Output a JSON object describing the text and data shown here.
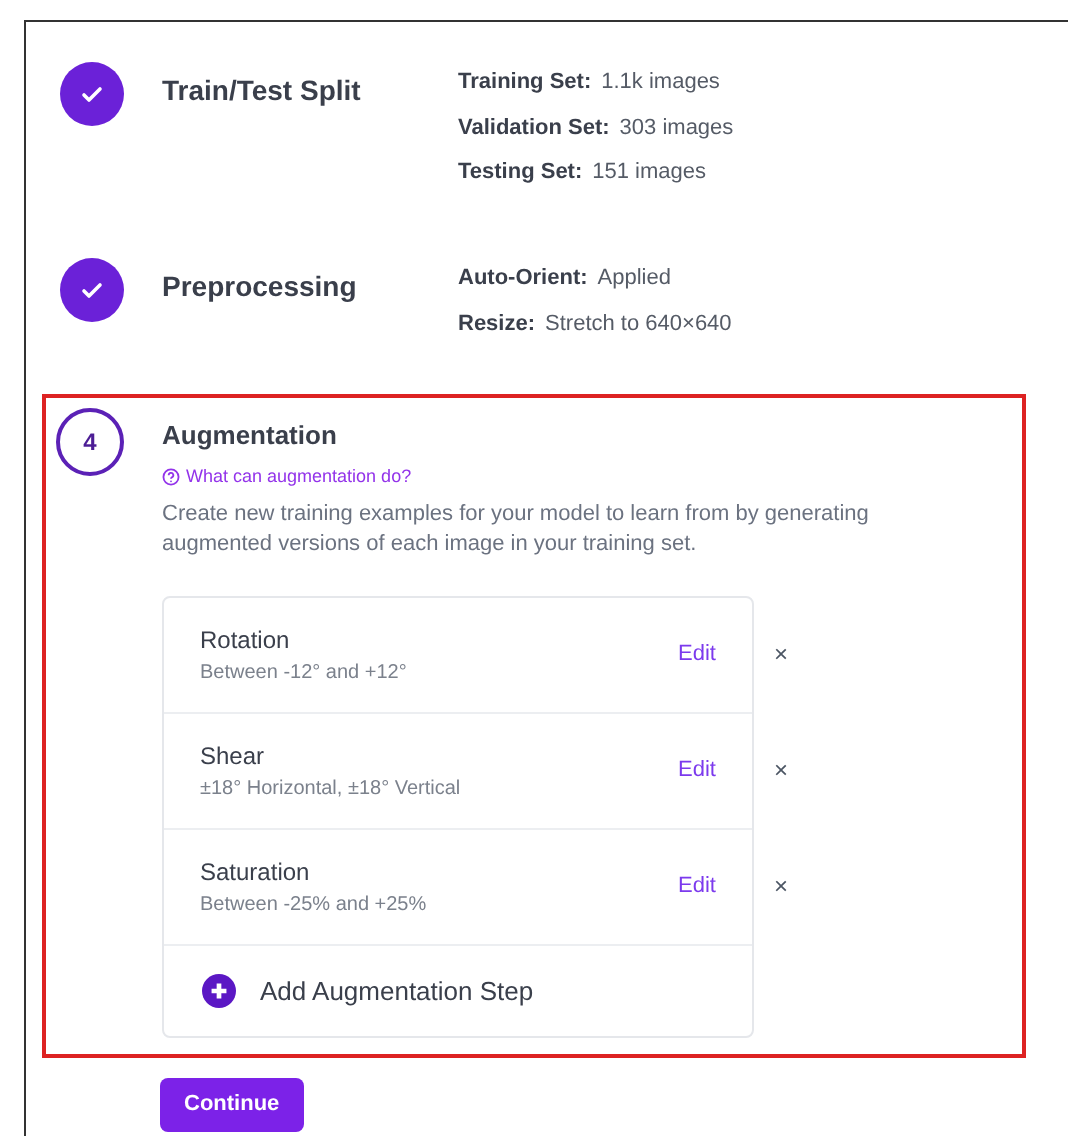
{
  "steps": [
    {
      "kind": "done",
      "title": "Train/Test Split",
      "details": [
        {
          "label": "Training Set:",
          "value": "1.1k images"
        },
        {
          "label": "Validation Set:",
          "value": "303 images"
        },
        {
          "label": "Testing Set:",
          "value": "151 images"
        }
      ]
    },
    {
      "kind": "done",
      "title": "Preprocessing",
      "details": [
        {
          "label": "Auto-Orient:",
          "value": "Applied"
        },
        {
          "label": "Resize:",
          "value": "Stretch to 640×640"
        }
      ]
    }
  ],
  "current": {
    "number": "4",
    "title": "Augmentation",
    "help_link": "What can augmentation do?",
    "description": "Create new training examples for your model to learn from by generating augmented versions of each image in your training set.",
    "augmentations": [
      {
        "name": "Rotation",
        "summary": "Between -12° and +12°",
        "edit": "Edit",
        "remove": "×"
      },
      {
        "name": "Shear",
        "summary": "±18° Horizontal, ±18° Vertical",
        "edit": "Edit",
        "remove": "×"
      },
      {
        "name": "Saturation",
        "summary": "Between -25% and +25%",
        "edit": "Edit",
        "remove": "×"
      }
    ],
    "add_step": "Add Augmentation Step"
  },
  "continue_button": "Continue"
}
